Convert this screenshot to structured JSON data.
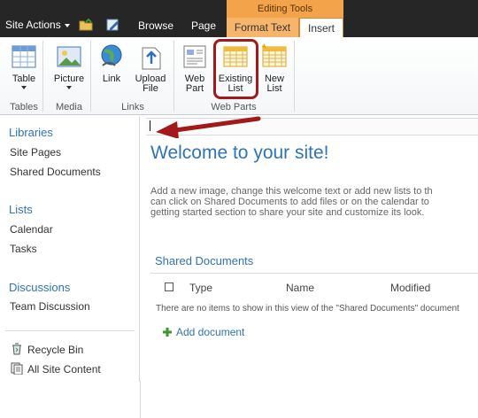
{
  "topbar": {
    "site_actions": "Site Actions",
    "tabs": [
      "Browse",
      "Page"
    ],
    "context_group": "Editing Tools",
    "format_text": "Format Text",
    "insert": "Insert"
  },
  "ribbon": {
    "buttons": [
      {
        "label1": "Table",
        "label2": "",
        "icon": "table-icon",
        "dropdown": true
      },
      {
        "label1": "Picture",
        "label2": "",
        "icon": "picture-icon",
        "dropdown": true
      },
      {
        "label1": "Link",
        "label2": "",
        "icon": "link-globe-icon",
        "dropdown": false
      },
      {
        "label1": "Upload",
        "label2": "File",
        "icon": "upload-file-icon",
        "dropdown": false
      },
      {
        "label1": "Web",
        "label2": "Part",
        "icon": "web-part-icon",
        "dropdown": false
      },
      {
        "label1": "Existing",
        "label2": "List",
        "icon": "existing-list-icon",
        "dropdown": false
      },
      {
        "label1": "New",
        "label2": "List",
        "icon": "new-list-icon",
        "dropdown": false
      }
    ],
    "groups": [
      "Tables",
      "Media",
      "Links",
      "Web Parts"
    ]
  },
  "leftnav": {
    "libraries": "Libraries",
    "library_items": [
      "Site Pages",
      "Shared Documents"
    ],
    "lists": "Lists",
    "list_items": [
      "Calendar",
      "Tasks"
    ],
    "discussions": "Discussions",
    "discussion_items": [
      "Team Discussion"
    ],
    "recycle_bin": "Recycle Bin",
    "all_site_content": "All Site Content"
  },
  "main": {
    "welcome": "Welcome to your site!",
    "intro_lines": [
      "Add a new image, change this welcome text or add new lists to th",
      "can click on Shared Documents to add files or on the calendar to",
      "getting started section to share your site and customize its look."
    ],
    "shared_docs_title": "Shared Documents",
    "columns": [
      "Type",
      "Name",
      "Modified"
    ],
    "empty_message": "There are no items to show in this view of the \"Shared Documents\" document",
    "add_document": "Add document"
  },
  "colors": {
    "topbar": "#262626",
    "context_tab": "#f3a34a",
    "link_blue": "#2e74b5",
    "annotation_red": "#a31818"
  }
}
